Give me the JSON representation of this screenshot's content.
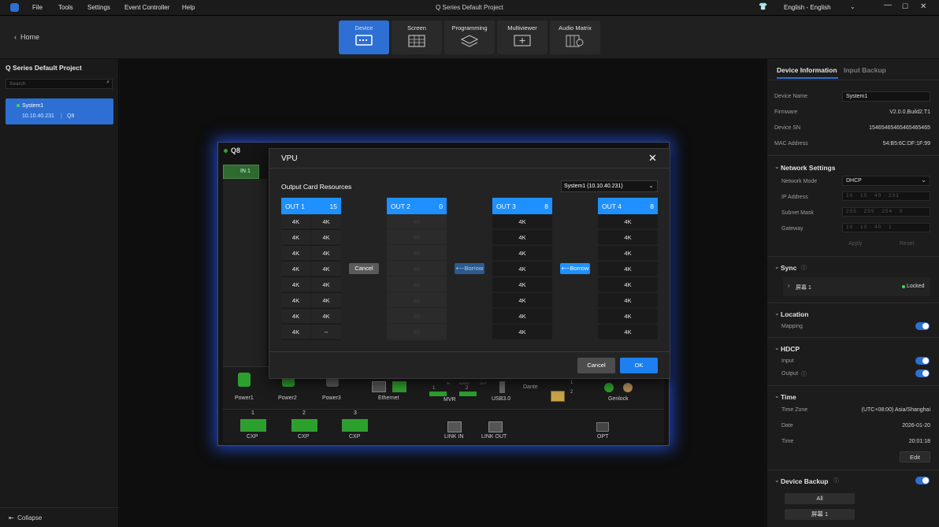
{
  "menu": [
    "File",
    "Tools",
    "Settings",
    "Event Controller",
    "Help"
  ],
  "window_title": "Q Series Default Project",
  "language": "English - English",
  "nav": {
    "home": "Home",
    "tabs": [
      {
        "label": "Device",
        "icon": "device-icon"
      },
      {
        "label": "Screen",
        "icon": "screen-icon"
      },
      {
        "label": "Programming",
        "icon": "layers-icon"
      },
      {
        "label": "Multiviewer",
        "icon": "multiviewer-icon"
      },
      {
        "label": "Audio Matrix",
        "icon": "audio-matrix-icon"
      }
    ],
    "active_tab": "Device"
  },
  "sidebar": {
    "project_title": "Q Series Default Project",
    "search_placeholder": "Search",
    "system": {
      "name": "System1",
      "ip": "10.10.40.231",
      "model": "Q8"
    },
    "collapse": "Collapse"
  },
  "device": {
    "name": "Q8",
    "in1": "IN 1",
    "ports_bottom": [
      "Power1",
      "Power2",
      "Power3",
      "Ethernet",
      "MVR",
      "USB3.0",
      "Dante",
      "Genlock"
    ],
    "mvr_nums": [
      "1",
      "2"
    ],
    "dante_nums": [
      "1",
      "2"
    ],
    "audio_labels": [
      "IN",
      "AUDIO",
      "OUT"
    ],
    "cxp": [
      {
        "num": "1",
        "label": "CXP"
      },
      {
        "num": "2",
        "label": "CXP"
      },
      {
        "num": "3",
        "label": "CXP"
      }
    ],
    "link_in": "LINK IN",
    "link_out": "LINK OUT",
    "opt": "OPT"
  },
  "dialog": {
    "title": "VPU",
    "section": "Output Card Resources",
    "system_select": "System1 (10.10.40.231)",
    "outputs": [
      {
        "name": "OUT 1",
        "count": "15",
        "cells": [
          [
            "4K",
            "4K"
          ],
          [
            "4K",
            "4K"
          ],
          [
            "4K",
            "4K"
          ],
          [
            "4K",
            "4K"
          ],
          [
            "4K",
            "4K"
          ],
          [
            "4K",
            "4K"
          ],
          [
            "4K",
            "4K"
          ],
          [
            "4K",
            "--"
          ]
        ]
      },
      {
        "name": "OUT 2",
        "count": "0",
        "cells": [
          "4K",
          "4K",
          "4K",
          "4K",
          "4K",
          "4K",
          "4K",
          "4K"
        ]
      },
      {
        "name": "OUT 3",
        "count": "8",
        "cells": [
          "4K",
          "4K",
          "4K",
          "4K",
          "4K",
          "4K",
          "4K",
          "4K"
        ]
      },
      {
        "name": "OUT 4",
        "count": "8",
        "cells": [
          "4K",
          "4K",
          "4K",
          "4K",
          "4K",
          "4K",
          "4K",
          "4K"
        ]
      }
    ],
    "cancel_mid": "Cancel",
    "borrow1": "⟵Borrow",
    "borrow2": "⟵Borrow",
    "cancel": "Cancel",
    "ok": "OK"
  },
  "right": {
    "tabs": [
      "Device Information",
      "Input Backup"
    ],
    "device_name_label": "Device Name",
    "device_name": "System1",
    "firmware_label": "Firmware",
    "firmware": "V2.0.0.Build2.T1",
    "sn_label": "Device SN",
    "sn": "15465465465465465465",
    "mac_label": "MAC Address",
    "mac": "54:B5:6C:DF:1F:99",
    "network": {
      "title": "Network Settings",
      "mode_label": "Network Mode",
      "mode": "DHCP",
      "ip_label": "IP Address",
      "ip": [
        "10",
        "10",
        "40",
        "231"
      ],
      "mask_label": "Subnet Mask",
      "mask": [
        "255",
        "255",
        "254",
        "0"
      ],
      "gw_label": "Gateway",
      "gw": [
        "10",
        "10",
        "40",
        "1"
      ],
      "apply": "Apply",
      "reset": "Reset"
    },
    "sync": {
      "title": "Sync",
      "screen": "屏幕 1",
      "status": "Locked"
    },
    "location": {
      "title": "Location",
      "mapping": "Mapping"
    },
    "hdcp": {
      "title": "HDCP",
      "input": "Input",
      "output": "Output"
    },
    "time": {
      "title": "Time",
      "zone_label": "Time Zone",
      "zone": "(UTC+08:00) Asia/Shanghai",
      "date_label": "Date",
      "date": "2026-01-20",
      "time_label": "Time",
      "time": "20:01:18",
      "edit": "Edit"
    },
    "backup": {
      "title": "Device Backup",
      "all": "All",
      "screen": "屏幕 1"
    }
  },
  "colors": {
    "accent": "#2d6fd3",
    "active_blue": "#1e90ff",
    "panel": "#1c1c1c",
    "green": "#2ca02c"
  }
}
